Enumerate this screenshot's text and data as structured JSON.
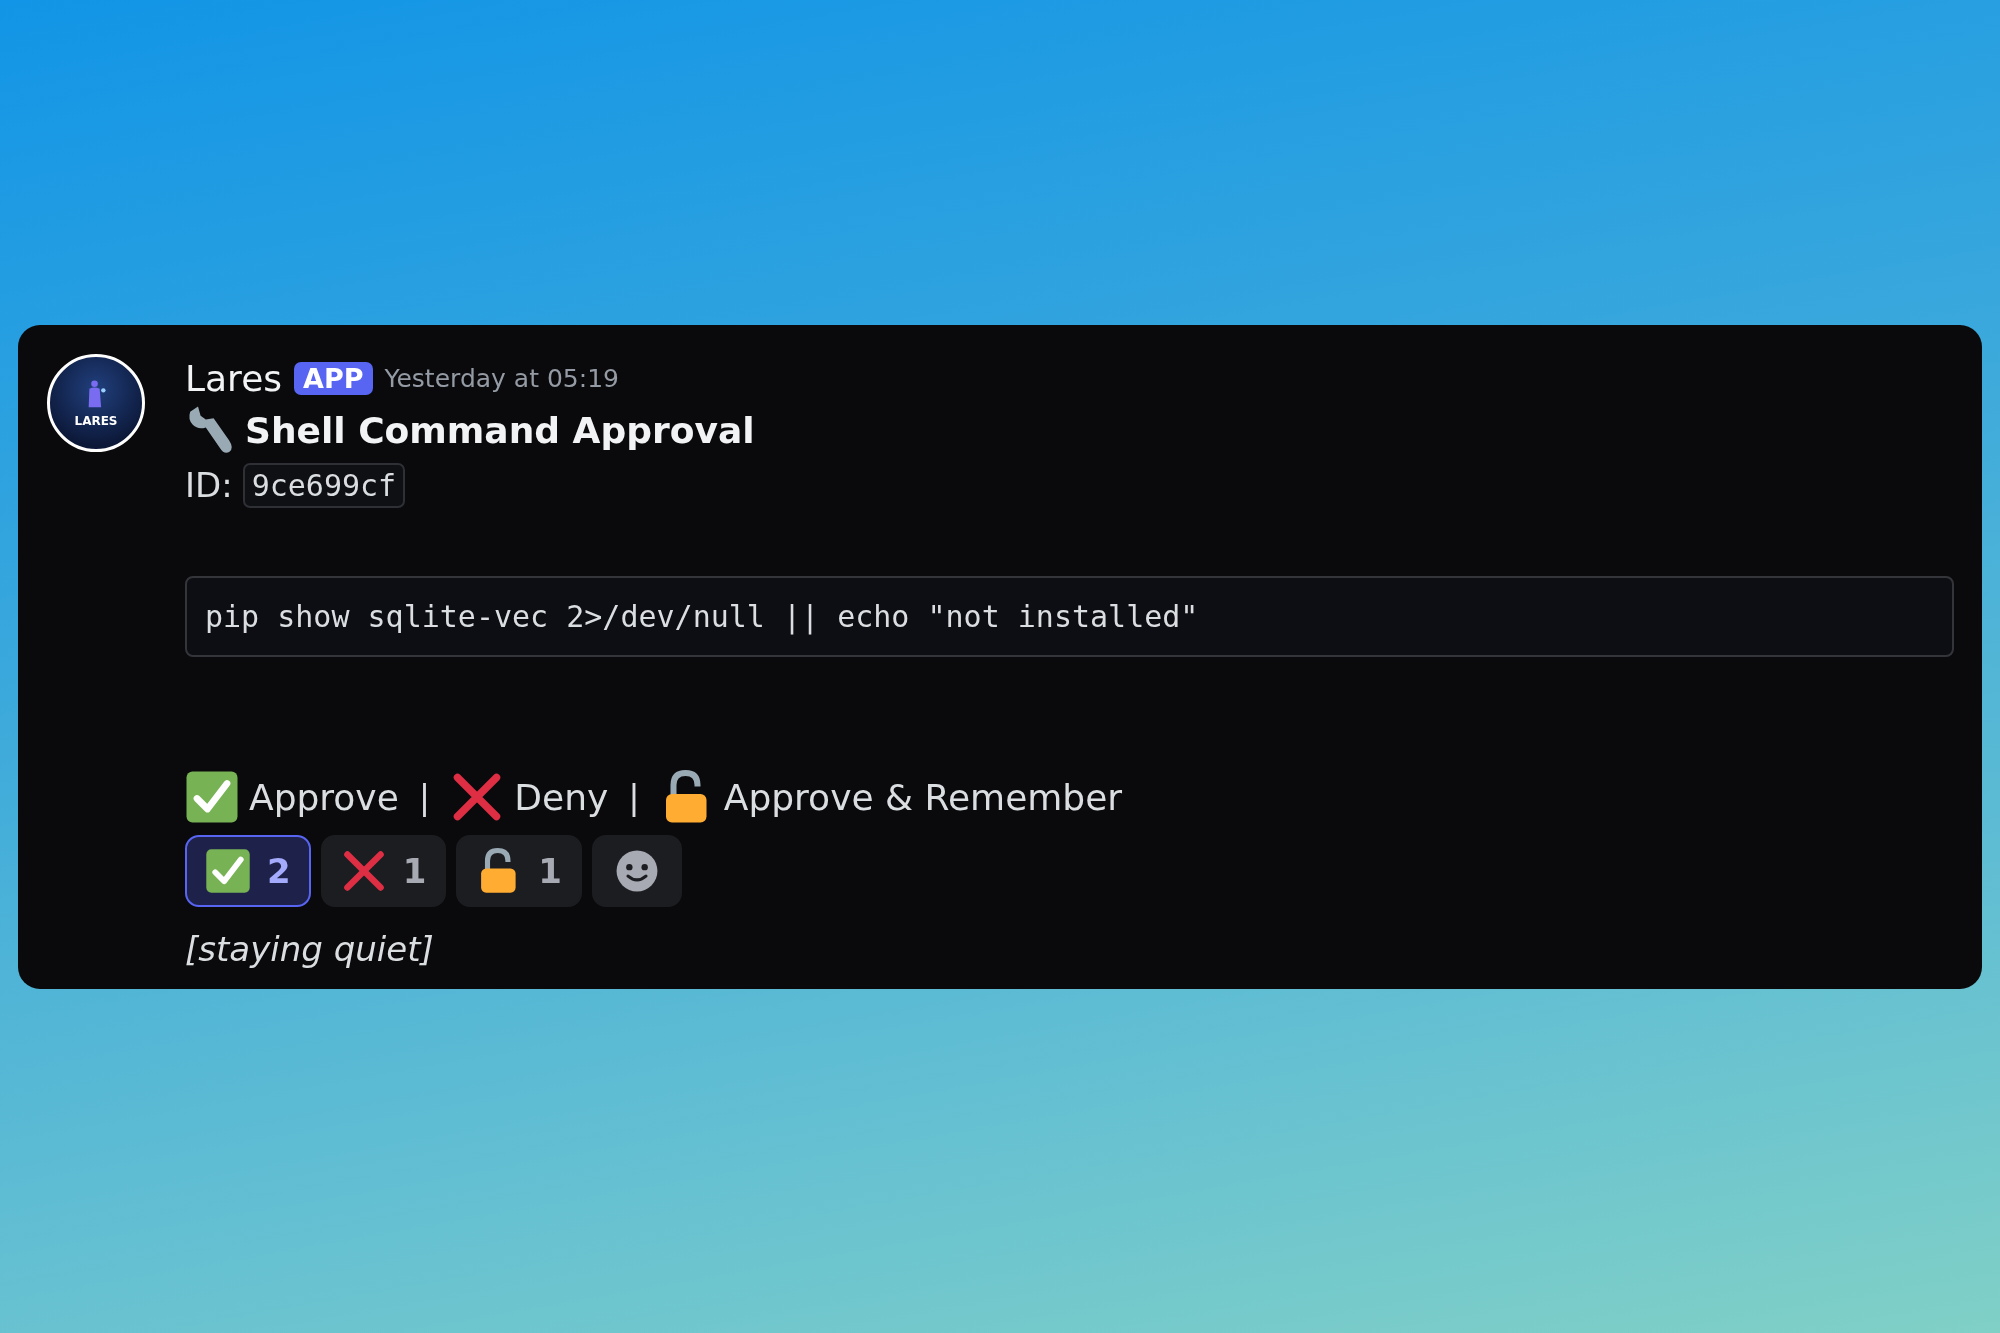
{
  "message": {
    "author": "Lares",
    "badge": "APP",
    "timestamp": "Yesterday at 05:19",
    "avatar_label": "LARES",
    "title": "Shell Command Approval",
    "id_label": "ID:",
    "id_value": "9ce699cf",
    "command": "pip show sqlite-vec 2>/dev/null || echo \"not installed\"",
    "options": [
      {
        "kind": "check",
        "label": "Approve",
        "separator": "|"
      },
      {
        "kind": "cross",
        "label": "Deny",
        "separator": "|"
      },
      {
        "kind": "lock",
        "label": "Approve & Remember"
      }
    ],
    "reactions": [
      {
        "kind": "check",
        "count": "2",
        "selected": true
      },
      {
        "kind": "cross",
        "count": "1",
        "selected": false
      },
      {
        "kind": "lock",
        "count": "1",
        "selected": false
      },
      {
        "kind": "add"
      }
    ],
    "footer": "[staying quiet]"
  }
}
